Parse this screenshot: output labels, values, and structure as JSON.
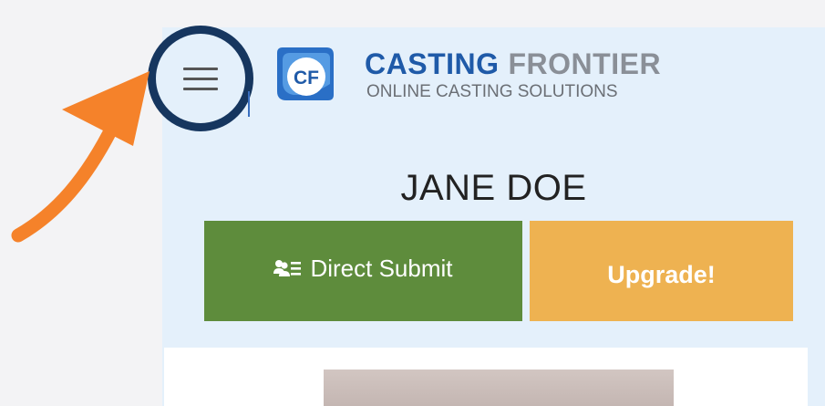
{
  "header": {
    "menu_icon": "hamburger-menu-icon",
    "logo": {
      "mark_text": "CF",
      "word1": "CASTING",
      "word2": "FRONTIER",
      "tagline": "ONLINE CASTING SOLUTIONS"
    }
  },
  "profile": {
    "name": "JANE DOE"
  },
  "actions": {
    "direct_submit": {
      "label": "Direct Submit",
      "icon": "users-list-icon"
    },
    "upgrade": {
      "label": "Upgrade!"
    }
  },
  "annotation": {
    "arrow_icon": "arrow-pointer-icon",
    "arrow_color": "#f5822a",
    "circle_color": "#16365f"
  },
  "colors": {
    "brand_blue": "#1f5aa8",
    "direct_submit_green": "#5e8c3c",
    "upgrade_gold": "#eeb251",
    "panel_bg": "#e4f0fb"
  }
}
